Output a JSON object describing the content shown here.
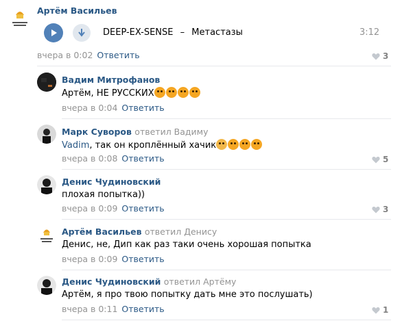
{
  "colors": {
    "link": "#2a5885",
    "meta": "#939393",
    "separator": "#e7e8ec",
    "play": "#5181b8"
  },
  "post": {
    "author": "Артём Васильев",
    "audio": {
      "artist": "DEEP-EX-SENSE",
      "dash": "–",
      "title": "Метастазы",
      "duration": "3:12"
    },
    "time": "вчера в 0:02",
    "reply_label": "Ответить",
    "likes": "3"
  },
  "comments": [
    {
      "author": "Вадим Митрофанов",
      "replied_to": "",
      "text": "Артём, НЕ РУССКИХ",
      "emoji_count": 4,
      "time": "вчера в 0:04",
      "reply_label": "Ответить",
      "likes": ""
    },
    {
      "author": "Марк Суворов",
      "replied_to": "ответил Вадиму",
      "mention": "Vadim",
      "text": ", так он кроплённый хачик",
      "emoji_count": 4,
      "time": "вчера в 0:08",
      "reply_label": "Ответить",
      "likes": "5"
    },
    {
      "author": "Денис Чудиновский",
      "replied_to": "",
      "text": "плохая попытка))",
      "time": "вчера в 0:09",
      "reply_label": "Ответить",
      "likes": "3"
    },
    {
      "author": "Артём Васильев",
      "replied_to": "ответил Денису",
      "text": "Денис, не, Дип как раз таки очень хорошая попытка",
      "time": "вчера в 0:09",
      "reply_label": "Ответить",
      "likes": ""
    },
    {
      "author": "Денис Чудиновский",
      "replied_to": "ответил Артёму",
      "text": "Артём, я про твою попытку дать мне это послушать)",
      "time": "вчера в 0:11",
      "reply_label": "Ответить",
      "likes": "1"
    }
  ]
}
